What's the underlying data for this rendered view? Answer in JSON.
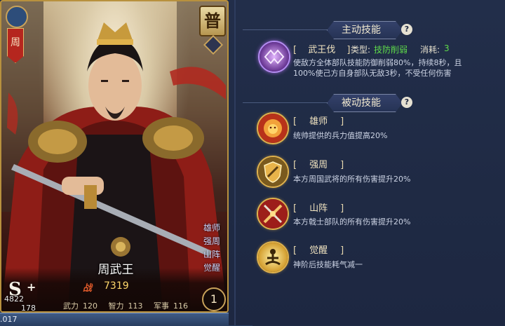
{
  "hero": {
    "name": "周武王",
    "grade_badge": "普",
    "banner_char": "周",
    "rank": "S",
    "rank_plus": "+",
    "power_label": "战",
    "power": "7319",
    "stats": [
      {
        "label": "武力",
        "value": "120"
      },
      {
        "label": "智力",
        "value": "113"
      },
      {
        "label": "军事",
        "value": "116"
      }
    ],
    "cost": "1",
    "skill_tags": [
      "雄师",
      "强周",
      "山阵",
      "觉醒"
    ]
  },
  "overlay_numbers": [
    "4822",
    "178",
    ".017"
  ],
  "active_section": {
    "title": "主动技能",
    "help": "?",
    "skill": {
      "name": "武王伐",
      "type_label": "类型:",
      "type_value": "技防削弱",
      "cost_label": "消耗:",
      "cost_value": "3",
      "desc_line1": "使敌方全体部队技能防御削弱80%，持续8秒，且",
      "desc_line2": "100%使己方自身部队无敌3秒，不受任何伤害"
    }
  },
  "passive_section": {
    "title": "被动技能",
    "help": "?",
    "skills": [
      {
        "name": "雄师",
        "icon": "lion-icon",
        "desc": "统帅提供的兵力值提高20%"
      },
      {
        "name": "强周",
        "icon": "shield-icon",
        "desc": "本方周国武将的所有伤害提升20%"
      },
      {
        "name": "山阵",
        "icon": "crossed-weapons-icon",
        "desc": "本方戟士部队的所有伤害提升20%"
      },
      {
        "name": "觉醒",
        "icon": "meditation-icon",
        "desc": "神阶后技能耗气减一"
      }
    ]
  },
  "colors": {
    "gold": "#e0b24c",
    "type_green": "#5fdc4a",
    "text": "#f0e3c0",
    "panel_bg": "#1f2a44"
  }
}
